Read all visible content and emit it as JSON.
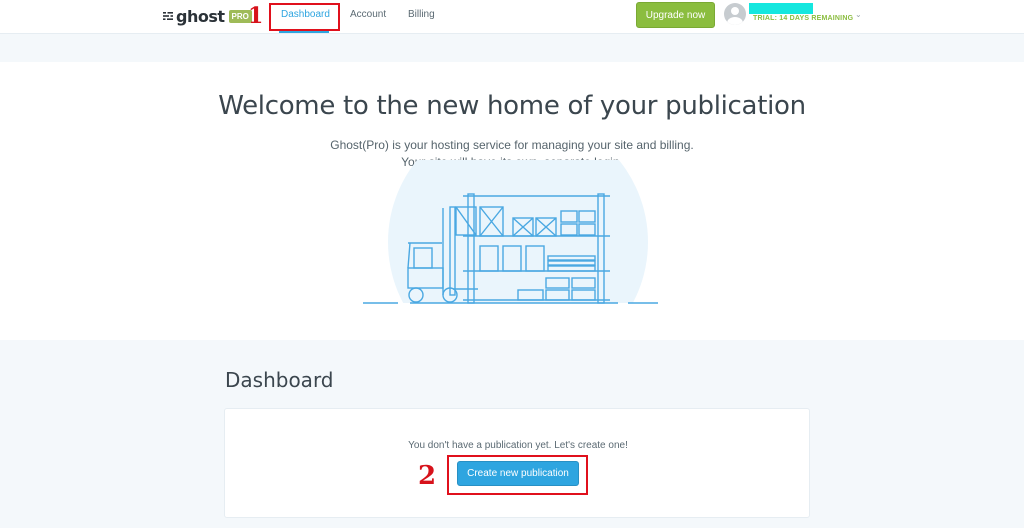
{
  "app": {
    "logo_text": "ghost",
    "logo_badge": "PRO"
  },
  "nav": {
    "items": [
      {
        "label": "Dashboard",
        "active": true
      },
      {
        "label": "Account",
        "active": false
      },
      {
        "label": "Billing",
        "active": false
      }
    ]
  },
  "header": {
    "upgrade_label": "Upgrade now",
    "trial_text": "TRIAL: 14 DAYS REMAINING"
  },
  "hero": {
    "title": "Welcome to the new home of your publication",
    "subtitle_line1": "Ghost(Pro) is your hosting service for managing your site and billing.",
    "subtitle_line2": "Your site will have its own, separate login."
  },
  "dashboard": {
    "title": "Dashboard",
    "empty_message": "You don't have a publication yet. Let's create one!",
    "create_label": "Create new publication"
  },
  "annotations": [
    {
      "label": "1"
    },
    {
      "label": "2"
    }
  ],
  "colors": {
    "accent": "#2ea5e0",
    "upgrade": "#8bbd3f",
    "annotation": "#e0101c",
    "redacted": "#15e7df"
  },
  "icons": [
    "ghost-logo-icon",
    "avatar-icon",
    "chevron-down-icon",
    "warehouse-illustration"
  ]
}
